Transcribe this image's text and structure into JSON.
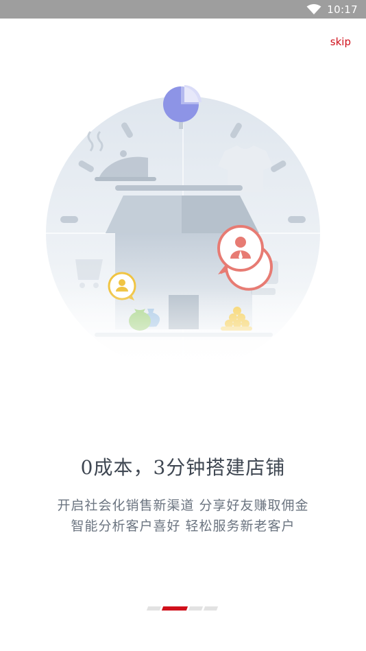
{
  "status_bar": {
    "time": "10:17",
    "icons": [
      "wifi-icon",
      "battery-icon"
    ]
  },
  "skip_label": "skip",
  "colors": {
    "accent": "#d0101b",
    "status_bar": "#9e9e9e",
    "headline": "#3f4752",
    "description": "#6b7480",
    "indicator_inactive": "#e2e2e2"
  },
  "illustration": {
    "icons": [
      "pie-chart-icon",
      "food-cloche-icon",
      "tshirt-icon",
      "store-house-icon",
      "salesperson-bubble-icon",
      "customer-bubble-icon",
      "money-bag-icon",
      "gold-coins-icon",
      "shopping-cart-icon"
    ]
  },
  "headline": "0成本，3分钟搭建店铺",
  "description": {
    "line1": "开启社会化销售新渠道 分享好友赚取佣金",
    "line2": "智能分析客户喜好 轻松服务新老客户"
  },
  "pager": {
    "count": 4,
    "active_index": 1
  }
}
